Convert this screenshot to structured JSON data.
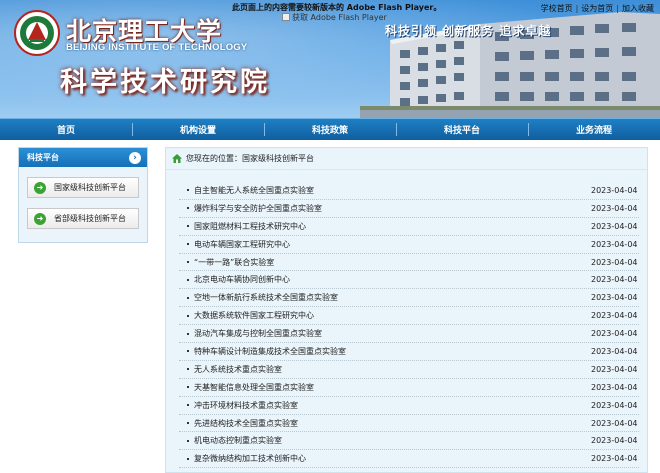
{
  "header": {
    "school_cn": "北京理工大学",
    "school_en": "BEIJING INSTITUTE OF TECHNOLOGY",
    "dept_title": "科学技术研究院",
    "flash_notice": "此页面上的内容需要较新版本的 Adobe Flash Player。",
    "flash_img_alt": "获取 Adobe Flash Player",
    "slogan": "科技引领  创新服务  追求卓越",
    "toplinks": [
      "学校首页",
      "设为首页",
      "加入收藏"
    ]
  },
  "nav": [
    "首页",
    "机构设置",
    "科技政策",
    "科技平台",
    "业务流程"
  ],
  "sidebar": {
    "title": "科技平台",
    "items": [
      "国家级科技创新平台",
      "省部级科技创新平台"
    ]
  },
  "breadcrumb": "您现在的位置：国家级科技创新平台",
  "list": [
    {
      "title": "自主智能无人系统全国重点实验室",
      "date": "2023-04-04"
    },
    {
      "title": "爆炸科学与安全防护全国重点实验室",
      "date": "2023-04-04"
    },
    {
      "title": "国家阻燃材料工程技术研究中心",
      "date": "2023-04-04"
    },
    {
      "title": "电动车辆国家工程研究中心",
      "date": "2023-04-04"
    },
    {
      "title": "“一带一路”联合实验室",
      "date": "2023-04-04"
    },
    {
      "title": "北京电动车辆协同创新中心",
      "date": "2023-04-04"
    },
    {
      "title": "空地一体新航行系统技术全国重点实验室",
      "date": "2023-04-04"
    },
    {
      "title": "大数据系统软件国家工程研究中心",
      "date": "2023-04-04"
    },
    {
      "title": "混动汽车集成与控制全国重点实验室",
      "date": "2023-04-04"
    },
    {
      "title": "特种车辆设计制造集成技术全国重点实验室",
      "date": "2023-04-04"
    },
    {
      "title": "无人系统技术重点实验室",
      "date": "2023-04-04"
    },
    {
      "title": "天基智能信息处理全国重点实验室",
      "date": "2023-04-04"
    },
    {
      "title": "冲击环境材料技术重点实验室",
      "date": "2023-04-04"
    },
    {
      "title": "先进结构技术全国重点实验室",
      "date": "2023-04-04"
    },
    {
      "title": "机电动态控制重点实验室",
      "date": "2023-04-04"
    },
    {
      "title": "复杂微纳结构加工技术创新中心",
      "date": "2023-04-04"
    }
  ]
}
